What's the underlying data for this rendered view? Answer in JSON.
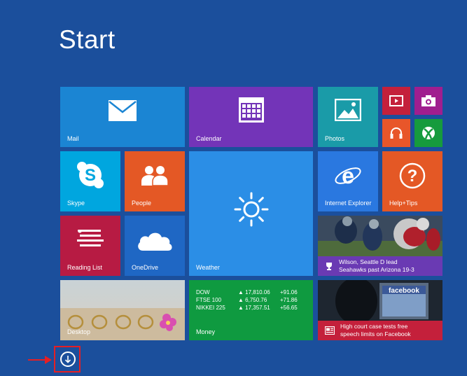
{
  "screen": {
    "title": "Start"
  },
  "tiles": {
    "mail": {
      "label": "Mail",
      "color": "#1b85d3"
    },
    "calendar": {
      "label": "Calendar",
      "color": "#7334b8"
    },
    "photos": {
      "label": "Photos",
      "color": "#1a9ba8"
    },
    "video": {
      "color": "#c4203b"
    },
    "camera": {
      "color": "#a01e8f"
    },
    "music": {
      "color": "#e8562a"
    },
    "games": {
      "color": "#169b3d"
    },
    "skype": {
      "label": "Skype",
      "color": "#00a6df"
    },
    "people": {
      "label": "People",
      "color": "#e45825"
    },
    "weather": {
      "label": "Weather",
      "color": "#2b8ee6"
    },
    "internet_explorer": {
      "label": "Internet Explorer",
      "color": "#2a78e0"
    },
    "help_tips": {
      "label": "Help+Tips",
      "color": "#e45825"
    },
    "sports": {
      "headline_line1": "Wilson, Seattle D lead",
      "headline_line2": "Seahawks past Arizona 19-3",
      "color": "#6a3ab3"
    },
    "reading_list": {
      "label": "Reading List",
      "color": "#b71b43"
    },
    "onedrive": {
      "label": "OneDrive",
      "color": "#1f67c4"
    },
    "desktop": {
      "label": "Desktop"
    },
    "money": {
      "label": "Money",
      "color": "#0f9a40",
      "rows": [
        {
          "name": "DOW",
          "value": "▲ 17,810.06",
          "change": "+91.06"
        },
        {
          "name": "FTSE 100",
          "value": "▲ 6,750.76",
          "change": "+71.86"
        },
        {
          "name": "NIKKEI 225",
          "value": "▲ 17,357.51",
          "change": "+56.65"
        }
      ]
    },
    "news": {
      "headline_line1": "High court case tests free",
      "headline_line2": "speech limits on Facebook",
      "color": "#c4203b",
      "screen_text": "facebook"
    }
  },
  "colors": {
    "background": "#1b4f9c",
    "highlight": "#e51f24"
  }
}
